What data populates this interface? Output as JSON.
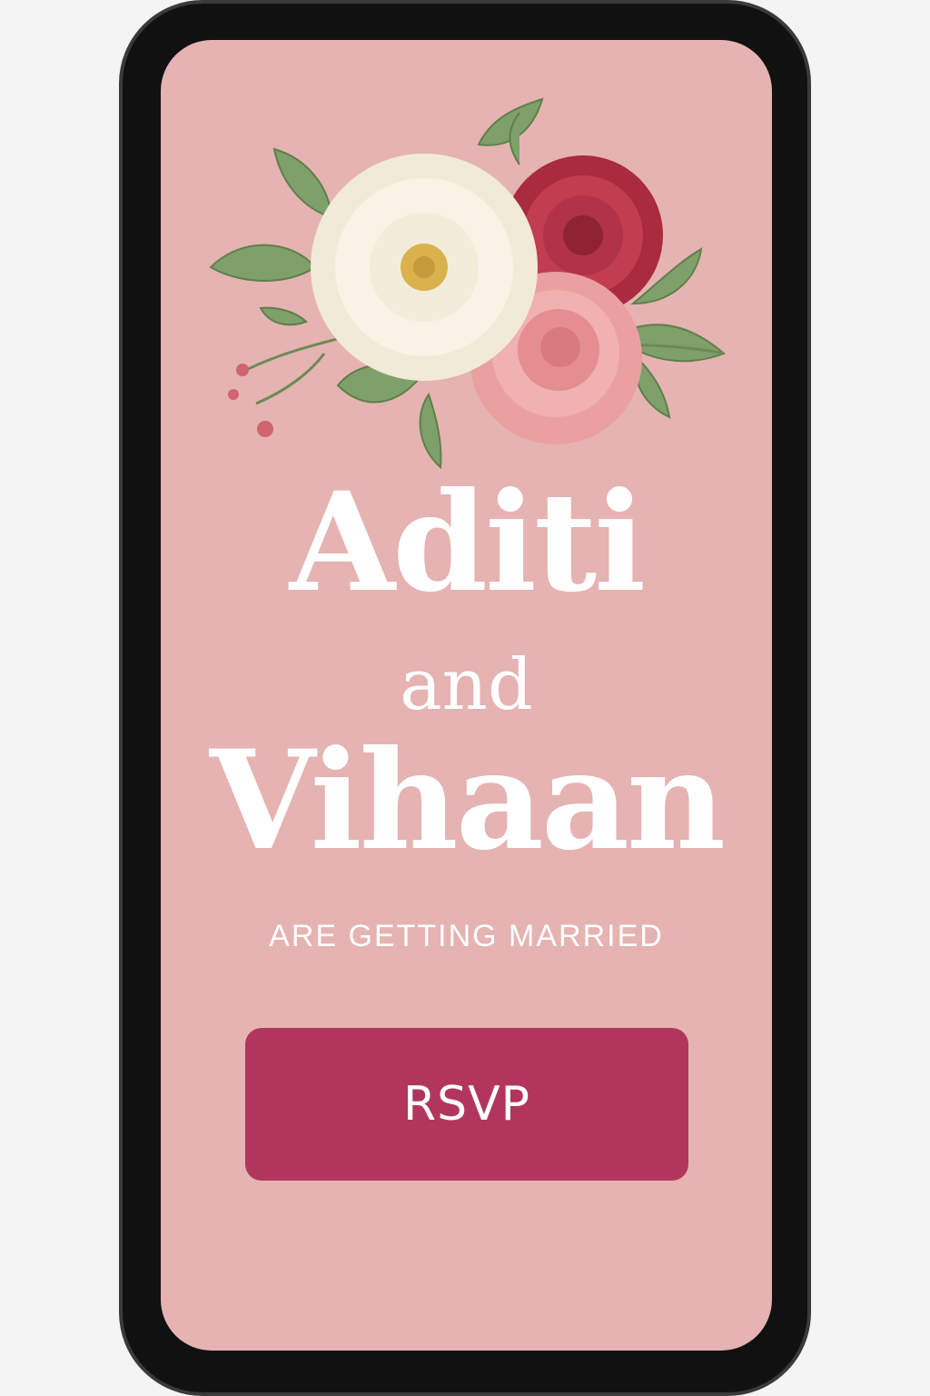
{
  "invitation": {
    "name_first": "Aditi",
    "connector": "and",
    "name_second": "Vihaan",
    "tagline": "ARE GETTING MARRIED",
    "rsvp_label": "RSVP"
  },
  "colors": {
    "background": "#f4f4f4",
    "phone_frame": "#111111",
    "screen": "#e5b3b2",
    "text": "#ffffff",
    "button": "#b2365c",
    "leaf": "#7fa06a",
    "white_flower": "#f7f1e3",
    "red_flower": "#b23344",
    "pink_rose": "#ec9b9c"
  },
  "icons": {
    "bouquet": "floral-bouquet-illustration"
  }
}
